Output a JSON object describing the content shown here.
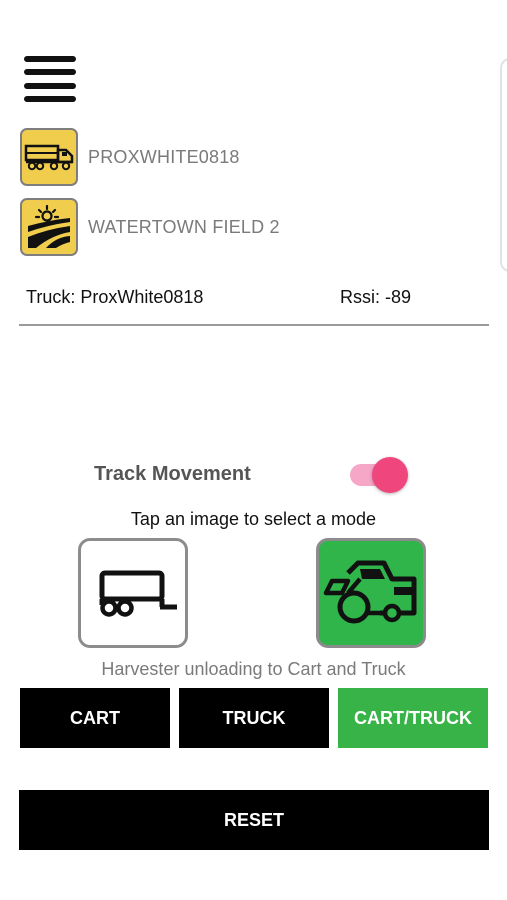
{
  "equipment": {
    "truck_name": "PROXWHITE0818",
    "field_name": "WATERTOWN FIELD 2"
  },
  "status": {
    "truck_label": "Truck: ProxWhite0818",
    "rssi_label": "Rssi: -89"
  },
  "track_movement": {
    "label": "Track Movement",
    "enabled": true
  },
  "mode": {
    "hint": "Tap an image to select a mode",
    "description": "Harvester unloading to Cart and Truck",
    "selected": "CART/TRUCK"
  },
  "buttons": {
    "cart": "CART",
    "truck": "TRUCK",
    "cart_truck": "CART/TRUCK",
    "reset": "RESET"
  },
  "colors": {
    "icon_background": "#f0cd4d",
    "active_green": "#38b348",
    "toggle_pink": "#f0467e"
  }
}
